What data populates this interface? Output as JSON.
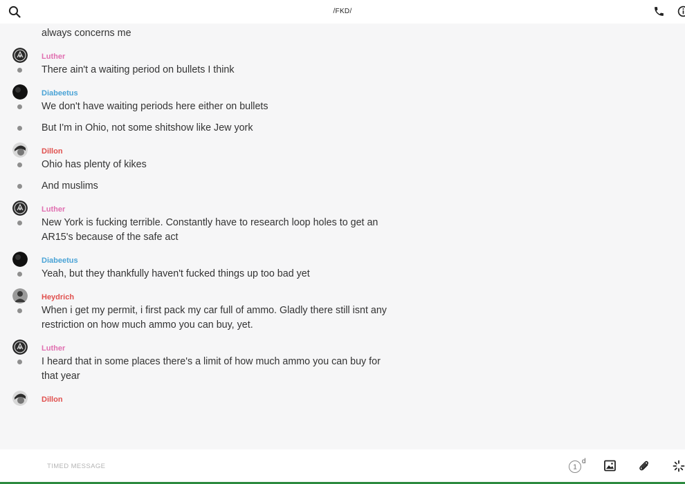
{
  "header": {
    "title": "/FKD/",
    "icons": {
      "left": "search-icon",
      "right": [
        "phone-icon",
        "info-icon"
      ]
    }
  },
  "colors": {
    "luther": "#e06fb0",
    "diabeetus": "#4aa3d6",
    "dillon": "#e0504e",
    "heydrich": "#e0504e"
  },
  "partial_top": {
    "text": "Hmmm...the south always has some interesting caveats but the lack of unions always concerns me"
  },
  "groups": [
    {
      "sender": "Luther",
      "messages": [
        "There ain't a waiting period on bullets I think"
      ]
    },
    {
      "sender": "Diabeetus",
      "messages": [
        "We don't have waiting periods here either on bullets",
        "But I'm in Ohio, not some shitshow like Jew york"
      ]
    },
    {
      "sender": "Dillon",
      "messages": [
        "Ohio has plenty of kikes",
        "And muslims"
      ]
    },
    {
      "sender": "Luther",
      "messages": [
        "New York is fucking terrible. Constantly have to research loop holes to get an AR15's because of the safe act"
      ]
    },
    {
      "sender": "Diabeetus",
      "messages": [
        "Yeah, but they thankfully haven't fucked things up too bad yet"
      ]
    },
    {
      "sender": "Heydrich",
      "messages": [
        "When i get my permit, i first pack my car full of ammo. Gladly there still isnt any restriction on how much ammo you can buy, yet."
      ]
    },
    {
      "sender": "Luther",
      "messages": [
        "I heard that in some places there's a limit of how much ammo you can buy for that year"
      ]
    },
    {
      "sender": "Dillon",
      "messages": []
    }
  ],
  "composer": {
    "placeholder": "TIMED MESSAGE",
    "timer_value": "1",
    "timer_unit": "d",
    "icons": [
      "timer-icon",
      "image-icon",
      "paperclip-icon",
      "sparkle-icon"
    ]
  }
}
